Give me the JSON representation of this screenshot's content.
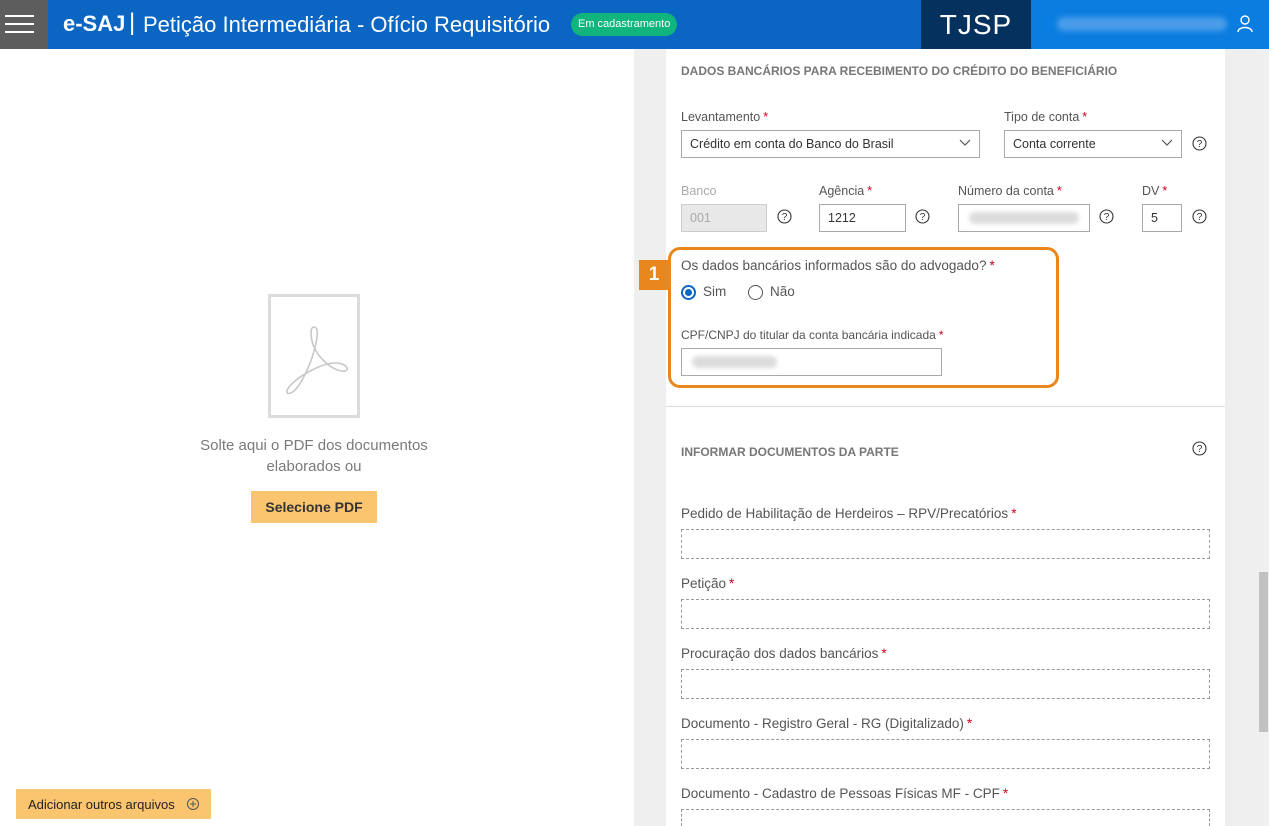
{
  "header": {
    "brand": "e-SAJ",
    "separator": "|",
    "title": "Petição Intermediária - Ofício Requisitório",
    "status_badge": "Em cadastramento",
    "court": "TJSP"
  },
  "left_panel": {
    "drop_text": "Solte aqui o PDF dos documentos elaborados ou",
    "select_pdf_label": "Selecione PDF",
    "add_files_label": "Adicionar outros arquivos"
  },
  "bank_section": {
    "title": "DADOS BANCÁRIOS PARA RECEBIMENTO DO CRÉDITO DO BENEFICIÁRIO",
    "levantamento_label": "Levantamento",
    "levantamento_value": "Crédito em conta do Banco do Brasil",
    "tipo_conta_label": "Tipo de conta",
    "tipo_conta_value": "Conta corrente",
    "banco_label": "Banco",
    "banco_value": "001",
    "agencia_label": "Agência",
    "agencia_value": "1212",
    "numero_conta_label": "Número da conta",
    "dv_label": "DV",
    "dv_value": "5",
    "required_mark": "*"
  },
  "lawyer_question": {
    "step_number": "1",
    "question": "Os dados bancários informados são do advogado?",
    "option_yes": "Sim",
    "option_no": "Não",
    "selected": "Sim",
    "cpf_label": "CPF/CNPJ do titular da conta bancária indicada"
  },
  "documents_section": {
    "title": "INFORMAR DOCUMENTOS DA PARTE",
    "items": [
      {
        "label": "Pedido de Habilitação de Herdeiros – RPV/Precatórios"
      },
      {
        "label": "Petição"
      },
      {
        "label": "Procuração dos dados bancários"
      },
      {
        "label": "Documento - Registro Geral - RG (Digitalizado)"
      },
      {
        "label": "Documento - Cadastro de Pessoas Físicas MF - CPF"
      }
    ]
  },
  "colors": {
    "header_blue": "#0b66c3",
    "tjsp_navy": "#05315e",
    "badge_green": "#10b47d",
    "highlight_orange": "#e8871e",
    "button_yellow": "#fbc56f"
  }
}
